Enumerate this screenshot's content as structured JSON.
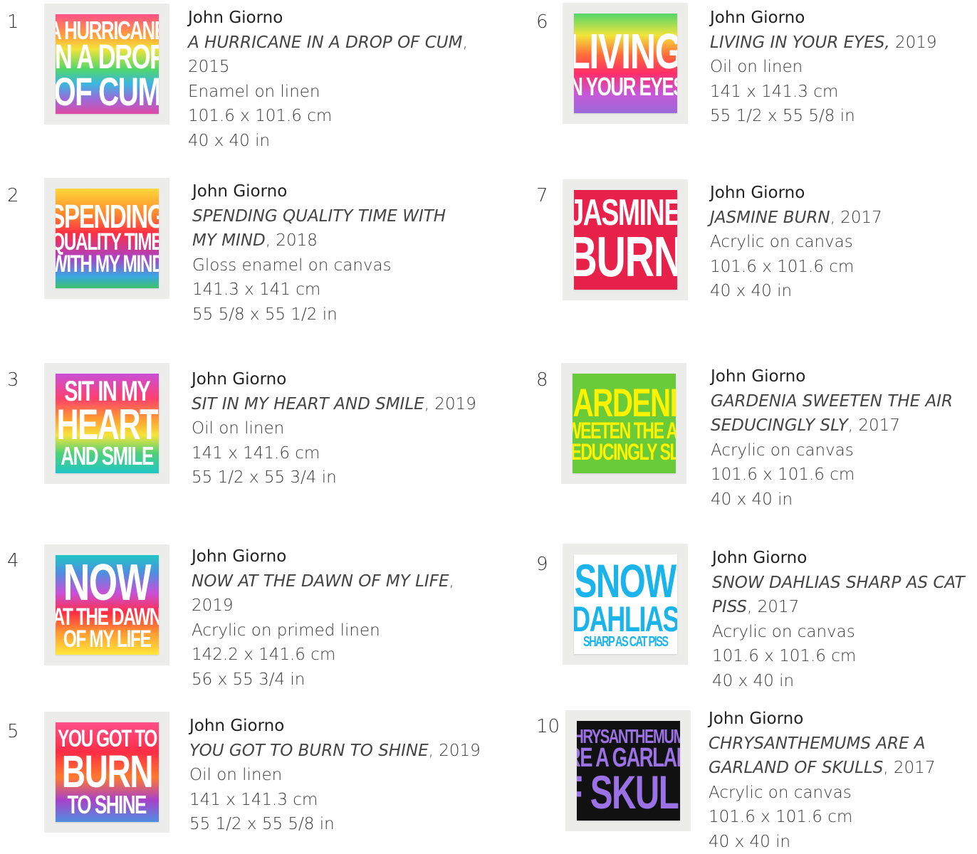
{
  "colors": {
    "rainbow1": "linear-gradient(180deg,#ff4f8a 0%,#ff9a3c 20%,#f2e43a 35%,#52d66a 55%,#3bb6e0 70%,#9a6ad8 85%,#e04aa6 100%)",
    "rainbow2": "linear-gradient(180deg,#ffd83a 0%,#ff8a2e 25%,#ff2d45 45%,#a742c8 70%,#3aa8e0 88%,#3bc26a 100%)",
    "rainbow3": "linear-gradient(180deg,#c850d8 0%,#ff3f6e 25%,#ff9a30 45%,#f6e43a 62%,#4fd07a 80%,#1fc6c6 100%)",
    "rainbow4": "linear-gradient(180deg,#52d66a 0%,#f2e43a 22%,#ff6a3a 42%,#ff2d6a 60%,#c856d8 80%,#9a6ad8 100%)",
    "rainbow5": "linear-gradient(180deg,#1fc6c6 0%,#4f8ee0 18%,#c850d8 38%,#ff2d45 58%,#ff9a30 78%,#ffe83a 100%)",
    "rainbow6": "linear-gradient(180deg,#ff4f8a 0%,#ff2d45 30%,#ff7a2e 55%,#a742c8 78%,#4f8ee0 100%)",
    "red": "#e8214a",
    "green": "#6acb3a",
    "white_art": "#ffffff",
    "black_art": "#111111",
    "yellow_text": "#fff200",
    "cyan_text": "#1ab4ea",
    "purple_text": "#9a72e6"
  },
  "items": [
    {
      "num": "1",
      "artist": "John Giorno",
      "lines": [
        {
          "title": "A HURRICANE IN A DROP OF CUM",
          "suffix": ","
        },
        {
          "text": "2015"
        }
      ],
      "medium": "Enamel on linen",
      "cm": "101.6 x 101.6 cm",
      "inch": "40 x 40 in",
      "art": [
        "A HURRICANE",
        "IN A DROP",
        "OF CUM"
      ]
    },
    {
      "num": "2",
      "artist": "John Giorno",
      "lines": [
        {
          "title": "SPENDING QUALITY TIME WITH"
        },
        {
          "title": "MY MIND",
          "suffix": ", 2018"
        }
      ],
      "medium": "Gloss enamel on canvas",
      "cm": "141.3 x 141 cm",
      "inch": "55 5/8 x 55 1/2 in",
      "art": [
        "SPENDING",
        "QUALITY TIME",
        "WITH MY MIND"
      ]
    },
    {
      "num": "3",
      "artist": "John Giorno",
      "lines": [
        {
          "title": "SIT IN MY HEART AND SMILE",
          "suffix": ", 2019"
        }
      ],
      "medium": "Oil on linen",
      "cm": "141 x 141.6 cm",
      "inch": "55 1/2 x 55 3/4 in",
      "art": [
        "SIT IN MY",
        "HEART",
        "AND SMILE"
      ]
    },
    {
      "num": "4",
      "artist": "John Giorno",
      "lines": [
        {
          "title": "NOW AT THE DAWN OF MY LIFE",
          "suffix": ","
        },
        {
          "text": "2019"
        }
      ],
      "medium": "Acrylic on primed linen",
      "cm": "142.2 x 141.6 cm",
      "inch": "56 x 55 3/4 in",
      "art": [
        "NOW",
        "AT THE DAWN",
        "OF MY LIFE"
      ]
    },
    {
      "num": "5",
      "artist": "John Giorno",
      "lines": [
        {
          "title": "YOU GOT TO BURN TO SHINE",
          "suffix": ", 2019"
        }
      ],
      "medium": "Oil on linen",
      "cm": "141 x 141.3 cm",
      "inch": "55 1/2 x 55 5/8 in",
      "art": [
        "YOU GOT TO",
        "BURN",
        "TO SHINE"
      ]
    },
    {
      "num": "6",
      "artist": "John Giorno",
      "lines": [
        {
          "title": "LIVING IN YOUR EYES,",
          "suffix": " 2019"
        }
      ],
      "medium": "Oil on linen",
      "cm": "141 x 141.3 cm",
      "inch": "55 1/2 x 55 5/8 in",
      "art": [
        "LIVING",
        "IN YOUR EYES"
      ]
    },
    {
      "num": "7",
      "artist": "John Giorno",
      "lines": [
        {
          "title": "JASMINE BURN",
          "suffix": ", 2017"
        }
      ],
      "medium": "Acrylic on canvas",
      "cm": "101.6 x 101.6 cm",
      "inch": "40 x 40 in",
      "art": [
        "JASMINE",
        "BURN"
      ]
    },
    {
      "num": "8",
      "artist": "John Giorno",
      "lines": [
        {
          "title": "GARDENIA SWEETEN THE AIR"
        },
        {
          "title": "SEDUCINGLY SLY",
          "suffix": ", 2017"
        }
      ],
      "medium": "Acrylic on canvas",
      "cm": "101.6 x 101.6 cm",
      "inch": "40 x 40 in",
      "art": [
        "GARDENIA",
        "SWEETEN THE AIR",
        "SEDUCINGLY SLY"
      ]
    },
    {
      "num": "9",
      "artist": "John Giorno",
      "lines": [
        {
          "title": "SNOW DAHLIAS SHARP AS CAT"
        },
        {
          "title": "PISS",
          "suffix": ", 2017"
        }
      ],
      "medium": "Acrylic on canvas",
      "cm": "101.6 x 101.6 cm",
      "inch": "40 x 40 in",
      "art": [
        "SNOW",
        "DAHLIAS",
        "SHARP AS CAT PISS"
      ]
    },
    {
      "num": "10",
      "artist": "John Giorno",
      "lines": [
        {
          "title": "CHRYSANTHEMUMS ARE A"
        },
        {
          "title": "GARLAND OF SKULLS",
          "suffix": ", 2017"
        }
      ],
      "medium": "Acrylic on canvas",
      "cm": "101.6 x 101.6 cm",
      "inch": "40 x 40 in",
      "art": [
        "CHRYSANTHEMUMS",
        "ARE A GARLAND",
        "OF SKULLS"
      ]
    }
  ]
}
